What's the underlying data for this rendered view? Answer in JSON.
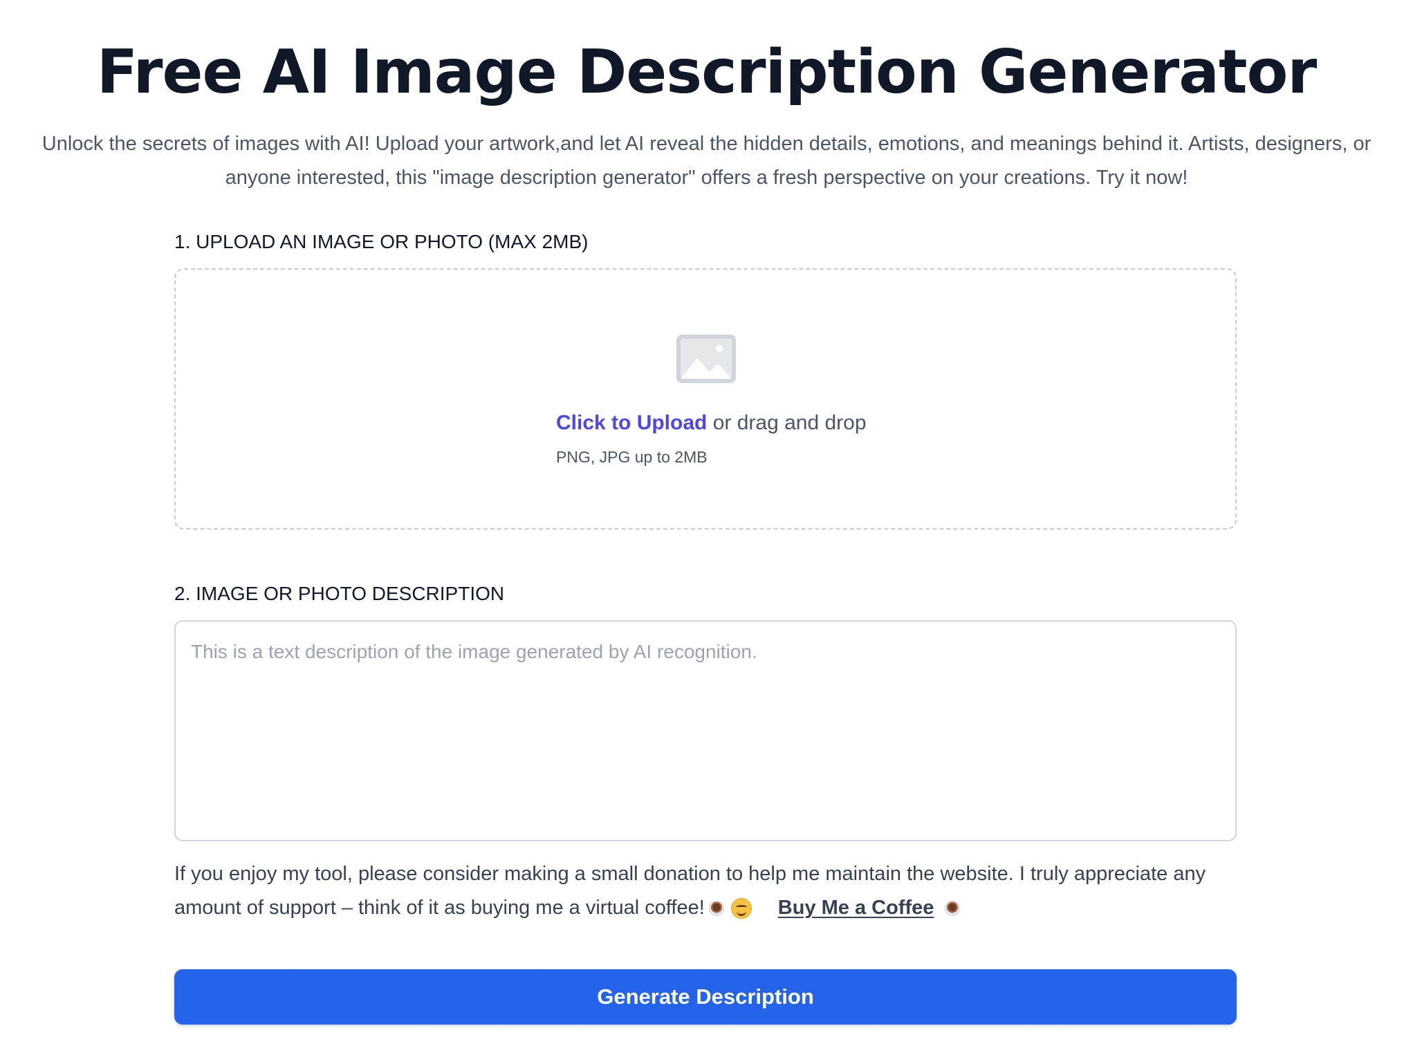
{
  "header": {
    "title": "Free AI Image Description Generator",
    "subtitle": "Unlock the secrets of images with AI! Upload your artwork,and let AI reveal the hidden details, emotions, and meanings behind it. Artists, designers, or anyone interested, this \"image description generator\" offers a fresh perspective on your creations. Try it now!"
  },
  "upload": {
    "label": "1. UPLOAD AN IMAGE OR PHOTO (MAX 2MB)",
    "icon": "image-placeholder-icon",
    "link_text": "Click to Upload",
    "drag_text": " or drag and drop",
    "hint": "PNG, JPG up to 2MB"
  },
  "description": {
    "label": "2. IMAGE OR PHOTO DESCRIPTION",
    "value": "",
    "placeholder": "This is a text description of the image generated by AI recognition."
  },
  "donation": {
    "text": "If you enjoy my tool, please consider making a small donation to help me maintain the website. I truly appreciate any amount of support – think of it as buying me a virtual coffee!",
    "link_text": "Buy Me a Coffee",
    "icons": [
      "coffee-icon",
      "smile-icon",
      "coffee-icon"
    ]
  },
  "actions": {
    "generate_label": "Generate Description"
  },
  "colors": {
    "accent": "#2563eb",
    "link": "#4f46e5",
    "heading": "#111827",
    "muted": "#4b5563",
    "border": "#d1d5db"
  }
}
